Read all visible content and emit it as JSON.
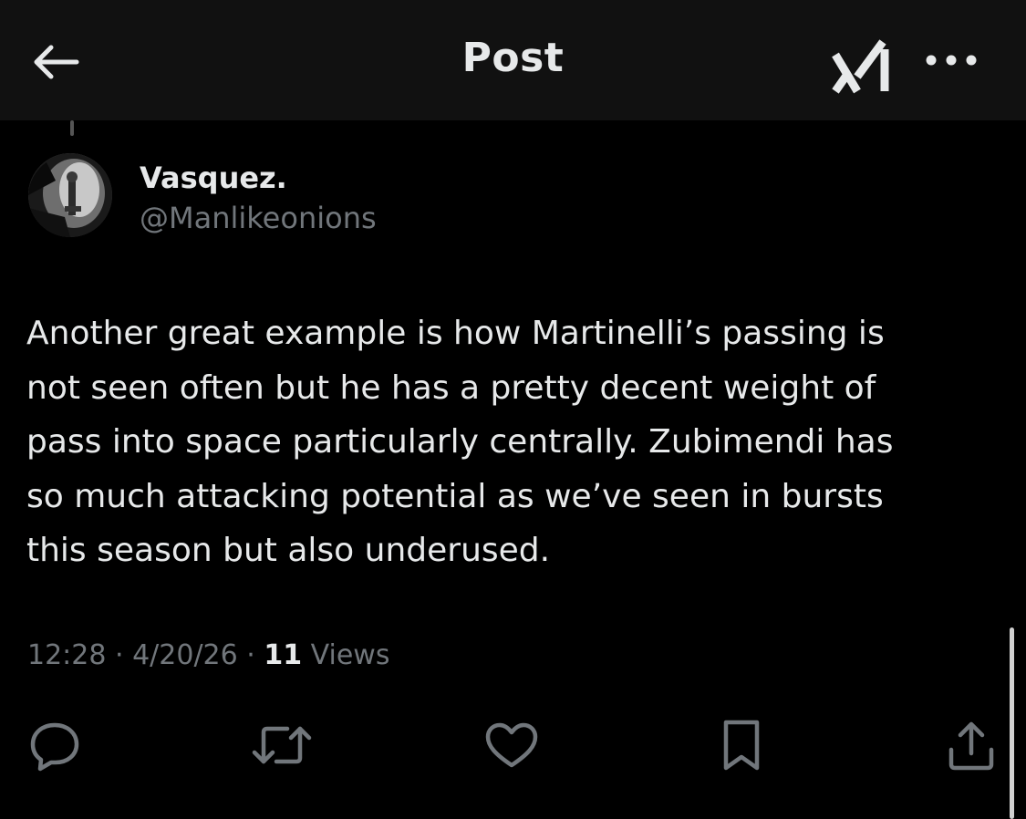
{
  "header": {
    "title": "Post",
    "back_icon": "arrow-left-icon",
    "grok_icon": "grok-icon",
    "more_icon": "more-horizontal-icon"
  },
  "author": {
    "display_name": "Vasquez.",
    "handle": "@Manlikeonions"
  },
  "post": {
    "text": "Another great example is how Martinelli’s passing is\nnot seen often but he has a pretty decent weight of\npass into space particularly centrally. Zubimendi has\nso much attacking potential as we’ve seen in bursts\nthis season but also underused."
  },
  "meta": {
    "time": "12:28",
    "sep1": " · ",
    "date": "4/20/26",
    "sep2": " · ",
    "views_count": "11",
    "views_label": " Views"
  },
  "actions": [
    {
      "name": "reply",
      "icon": "reply-icon"
    },
    {
      "name": "repost",
      "icon": "repost-icon"
    },
    {
      "name": "like",
      "icon": "heart-icon"
    },
    {
      "name": "bookmark",
      "icon": "bookmark-icon"
    },
    {
      "name": "share",
      "icon": "share-icon"
    }
  ],
  "colors": {
    "background": "#000000",
    "header_background": "#111111",
    "text_primary": "#e7e9ea",
    "text_secondary": "#71767b"
  }
}
